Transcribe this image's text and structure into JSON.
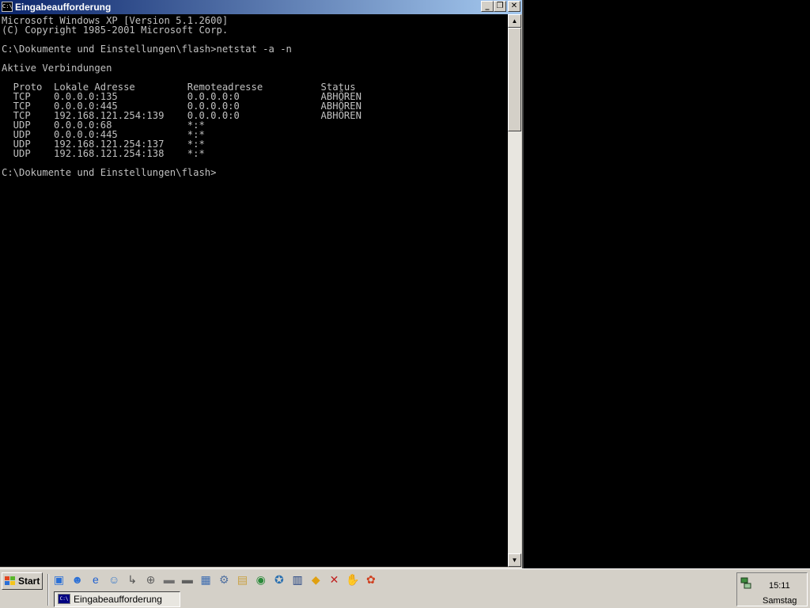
{
  "window": {
    "title": "Eingabeaufforderung",
    "icon": "console-icon",
    "console_lines": [
      "Microsoft Windows XP [Version 5.1.2600]",
      "(C) Copyright 1985-2001 Microsoft Corp.",
      "",
      "C:\\Dokumente und Einstellungen\\flash>netstat -a -n",
      "",
      "Aktive Verbindungen",
      "",
      "  Proto  Lokale Adresse         Remoteadresse          Status",
      "  TCP    0.0.0.0:135            0.0.0.0:0              ABHÖREN",
      "  TCP    0.0.0.0:445            0.0.0.0:0              ABHÖREN",
      "  TCP    192.168.121.254:139    0.0.0.0:0              ABHÖREN",
      "  UDP    0.0.0.0:68             *:*",
      "  UDP    0.0.0.0:445            *:*",
      "  UDP    192.168.121.254:137    *:*",
      "  UDP    192.168.121.254:138    *:*",
      "",
      "C:\\Dokumente und Einstellungen\\flash>"
    ]
  },
  "taskbar": {
    "start_label": "Start",
    "task_label": "Eingabeaufforderung",
    "quicklaunch_icons": [
      "show-desktop-icon",
      "messenger-icon",
      "internet-explorer-icon",
      "user-icon",
      "shortcut-icon",
      "network-icon",
      "drive-icon",
      "drive2-icon",
      "computer-icon",
      "settings-icon",
      "folder-icon",
      "globe-icon",
      "tool-icon",
      "screen-icon",
      "paint-icon",
      "media-icon",
      "hand-icon",
      "game-icon"
    ],
    "clock_time": "15:11",
    "clock_day": "Samstag"
  },
  "colors": {
    "title_start": "#0a246a",
    "title_end": "#a6caf0",
    "console_bg": "#000000",
    "console_fg": "#c0c0c0",
    "chrome": "#d4d0c8"
  }
}
